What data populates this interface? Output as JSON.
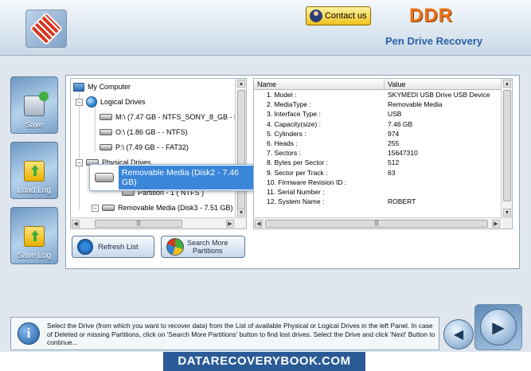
{
  "header": {
    "contact_label": "Contact us",
    "brand": "DDR",
    "tagline": "Pen Drive Recovery"
  },
  "sidebar": {
    "save_label": "Save",
    "load_log_label": "Load Log",
    "save_log_label": "Save Log"
  },
  "tree": {
    "root": "My Computer",
    "logical_drives": "Logical Drives",
    "drive_m": "M:\\ (7.47 GB - NTFS_SONY_8_GB - NT",
    "drive_o": "O:\\ (1.86 GB -  - NTFS)",
    "drive_p": "P:\\ (7.49 GB -  - FAT32)",
    "physical_drives": "Physical Drives",
    "selected_disk": "Removable Media (Disk2 - 7.46 GB)",
    "partition": "Partition - 1 ( NTFS )",
    "disk3": "Removable Media (Disk3 - 7.51 GB)"
  },
  "grid": {
    "col_name": "Name",
    "col_value": "Value",
    "rows": [
      {
        "name": "1. Model :",
        "value": "SKYMEDI USB Drive USB Device"
      },
      {
        "name": "2. MediaType :",
        "value": "Removable Media"
      },
      {
        "name": "3. Interface Type :",
        "value": "USB"
      },
      {
        "name": "4. Capacity(size) :",
        "value": "7.46 GB"
      },
      {
        "name": "5. Cylinders :",
        "value": "974"
      },
      {
        "name": "6. Heads :",
        "value": "255"
      },
      {
        "name": "7. Sectors :",
        "value": "15647310"
      },
      {
        "name": "8. Bytes per Sector :",
        "value": "512"
      },
      {
        "name": "9. Sector per Track :",
        "value": "63"
      },
      {
        "name": "10. Firmware Revision ID :",
        "value": ""
      },
      {
        "name": "11. Serial Number :",
        "value": ""
      },
      {
        "name": "12. System Name :",
        "value": "ROBERT"
      }
    ]
  },
  "actions": {
    "refresh_label": "Refresh List",
    "search_label_1": "Search More",
    "search_label_2": "Partitions"
  },
  "info": {
    "text": "Select the Drive (from which you want to recover data) from the List of available Physical or Logical Drives in the left Panel. In case of Deleted or missing Partitions, click on 'Search More Partitions' button to find lost drives. Select the Drive and click 'Next' Button to continue..."
  },
  "footer": {
    "site": "DATARECOVERYBOOK.COM"
  }
}
